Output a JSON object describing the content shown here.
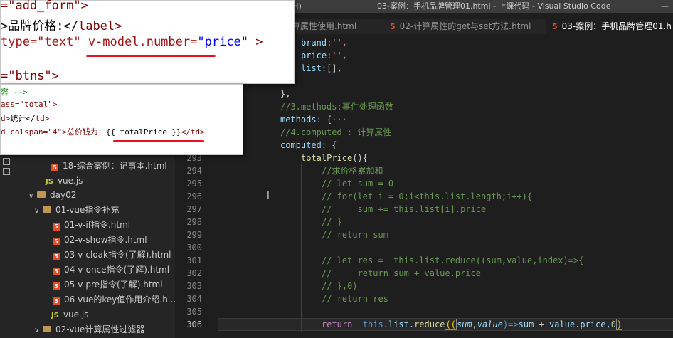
{
  "titlebar": {
    "menu": "助(H)",
    "title": "03-案例：手机品牌管理01.html - 上课代码 - Visual Studio Code",
    "control": "—"
  },
  "tabs": [
    {
      "label": "算属性使用.html",
      "active": false
    },
    {
      "label": "02-计算属性的get与set方法.html",
      "active": false
    },
    {
      "label": "03-案例：手机品牌管理01.h",
      "active": true
    }
  ],
  "popup_top": {
    "line1": "=\"add_form\">",
    "line2_a": "品牌价格:</",
    "line2_b": "label",
    ">": ">",
    "line3_a": "type=\"text\" ",
    "line3_b": "v-model.number=",
    "line3_c": "\"price\"",
    "line3_d": " >",
    "line4": "=\"btns\">"
  },
  "popup_bottom": {
    "line1": "容 -->",
    "line2": "ass=\"total\">",
    "line3_a": "d>",
    "line3_b": "统计</",
    "line3_c": "td",
    "line4_a": "d colspan=\"4\">总价钱为：",
    "line4_b": "{{ totalPrice }}",
    "line4_c": "</td>"
  },
  "sidebar": {
    "items": [
      {
        "label": "18-综合案例：记事本.html",
        "type": "html"
      },
      {
        "label": "vue.js",
        "type": "js"
      },
      {
        "label": "day02",
        "type": "folder"
      },
      {
        "label": "01-vue指令补充",
        "type": "folder"
      },
      {
        "label": "01-v-if指令.html",
        "type": "html"
      },
      {
        "label": "02-v-show指令.html",
        "type": "html"
      },
      {
        "label": "03-v-cloak指令(了解).html",
        "type": "html"
      },
      {
        "label": "04-v-once指令(了解).html",
        "type": "html"
      },
      {
        "label": "05-v-pre指令(了解).html",
        "type": "html"
      },
      {
        "label": "06-vue的key值作用介绍.h...",
        "type": "html"
      },
      {
        "label": "vue.js",
        "type": "js"
      },
      {
        "label": "02-vue计算属性过滤器",
        "type": "folder"
      }
    ]
  },
  "line_numbers": [
    "293",
    "294",
    "295",
    "296",
    "297",
    "298",
    "299",
    "300",
    "301",
    "302",
    "303",
    "304",
    "305",
    "306"
  ],
  "code": {
    "l1_a": "brand:",
    "l1_b": "'',",
    "l2_a": "price:",
    "l2_b": "'',",
    "l3_a": "list:",
    "l3_b": "[],",
    "l5": "},",
    "l6": "//3.methods:事件处理函数",
    "l7_a": "methods: {",
    "l7_b": "···",
    "l8": "//4.computed : 计算属性",
    "l9_a": "computed",
    "l9_b": ": {",
    "l10_a": "totalPrice",
    "l10_b": "(){",
    "l11": "//求价格累加和",
    "l12": "// let sum = 0",
    "l13": "// for(let i = 0;i<this.list.length;i++){",
    "l14": "//     sum += this.list[i].price",
    "l15": "// }",
    "l16": "// return sum",
    "l18": "// let res =  this.list.reduce((sum,value,index)=>{",
    "l19": "//     return sum + value.price",
    "l20": "// },0)",
    "l21": "// return res",
    "l23_a": "return",
    "l23_b": "this",
    "l23_c": ".list.",
    "l23_d": "reduce",
    "l23_e": "((",
    "l23_f": "sum",
    "l23_g": ",",
    "l23_h": "value",
    "l23_i": ")=>",
    "l23_j": "sum",
    "l23_k": " + ",
    "l23_l": "value",
    "l23_m": ".price,",
    "l23_n": "0",
    "l23_o": ")"
  },
  "colors": {
    "accent": "#e81123",
    "html_icon": "#e44d26"
  }
}
